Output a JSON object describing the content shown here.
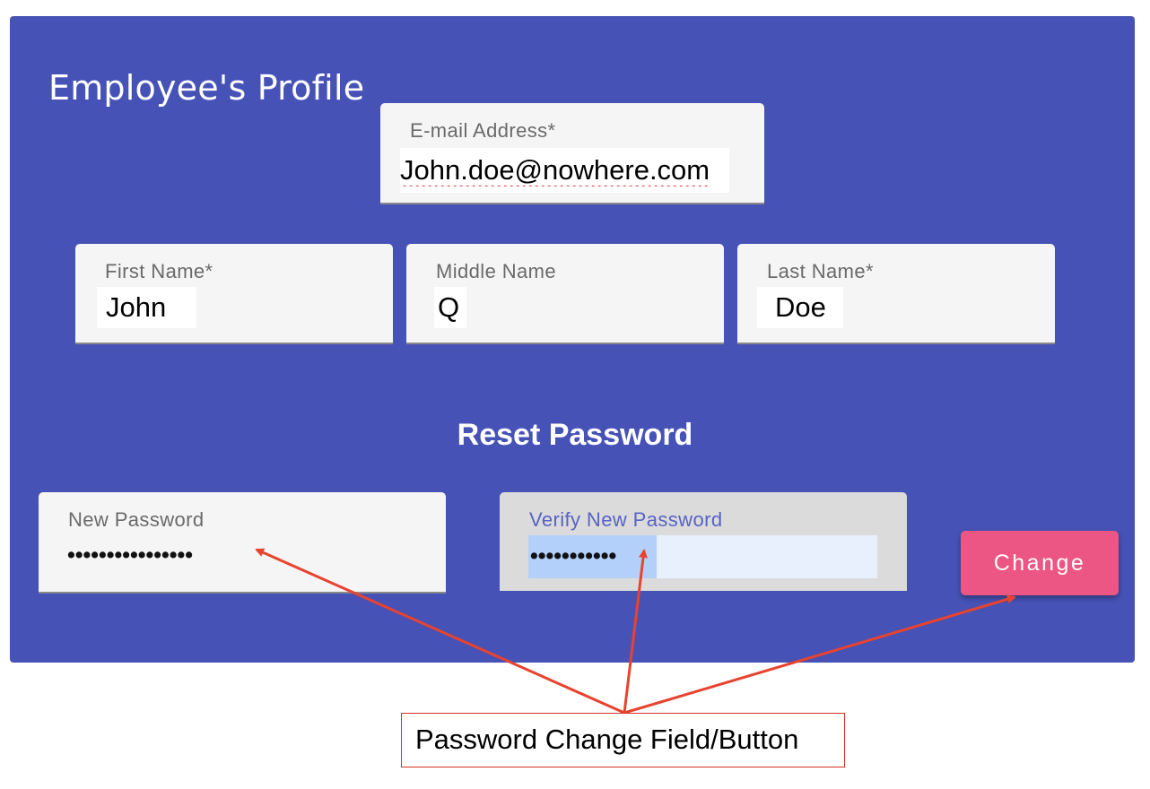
{
  "profile": {
    "title": "Employee's Profile",
    "email": {
      "label": "E-mail Address*",
      "value": "John.doe@nowhere.com"
    },
    "first_name": {
      "label": "First Name*",
      "value": "John"
    },
    "middle_name": {
      "label": "Middle Name",
      "value": "Q"
    },
    "last_name": {
      "label": "Last Name*",
      "value": "Doe"
    }
  },
  "reset_password": {
    "title": "Reset Password",
    "new_password": {
      "label": "New Password",
      "masked_value": "••••••••••••••••"
    },
    "verify_password": {
      "label": "Verify New Password",
      "masked_value": "•••••••••••"
    },
    "change_label": "Change"
  },
  "annotation": {
    "callout_text": "Password Change Field/Button"
  },
  "colors": {
    "card_background": "#4652b6",
    "button_accent": "#ec5684",
    "annotation_red": "#d6322a",
    "focused_label": "#5664c4"
  }
}
